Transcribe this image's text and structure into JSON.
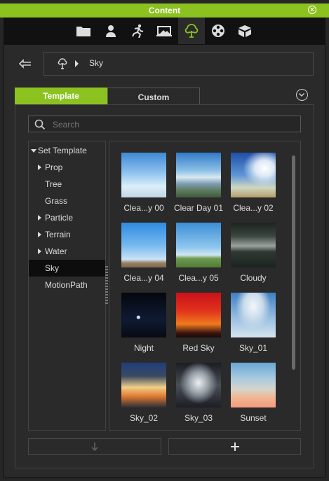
{
  "window": {
    "title": "Content"
  },
  "toolbar": {
    "tabs": [
      {
        "icon": "folder-icon"
      },
      {
        "icon": "person-icon"
      },
      {
        "icon": "motion-icon"
      },
      {
        "icon": "stage-icon"
      },
      {
        "icon": "tree-icon",
        "active": true
      },
      {
        "icon": "film-reel-icon"
      },
      {
        "icon": "box-icon"
      }
    ]
  },
  "breadcrumb": {
    "current": "Sky"
  },
  "tabs": {
    "template": "Template",
    "custom": "Custom"
  },
  "search": {
    "placeholder": "Search",
    "value": ""
  },
  "tree": {
    "root": "Set Template",
    "items": [
      {
        "label": "Prop",
        "expandable": true
      },
      {
        "label": "Tree",
        "expandable": false
      },
      {
        "label": "Grass",
        "expandable": false
      },
      {
        "label": "Particle",
        "expandable": true
      },
      {
        "label": "Terrain",
        "expandable": true
      },
      {
        "label": "Water",
        "expandable": true
      },
      {
        "label": "Sky",
        "expandable": false,
        "selected": true
      },
      {
        "label": "MotionPath",
        "expandable": false
      }
    ]
  },
  "items": [
    {
      "label": "Clea...y 00"
    },
    {
      "label": "Clear Day 01"
    },
    {
      "label": "Clea...y 02"
    },
    {
      "label": "Clea...y 04"
    },
    {
      "label": "Clea...y 05"
    },
    {
      "label": "Cloudy"
    },
    {
      "label": "Night"
    },
    {
      "label": "Red Sky"
    },
    {
      "label": "Sky_01"
    },
    {
      "label": "Sky_02"
    },
    {
      "label": "Sky_03"
    },
    {
      "label": "Sunset"
    }
  ],
  "colors": {
    "accent": "#8cc21f",
    "background": "#262626"
  }
}
